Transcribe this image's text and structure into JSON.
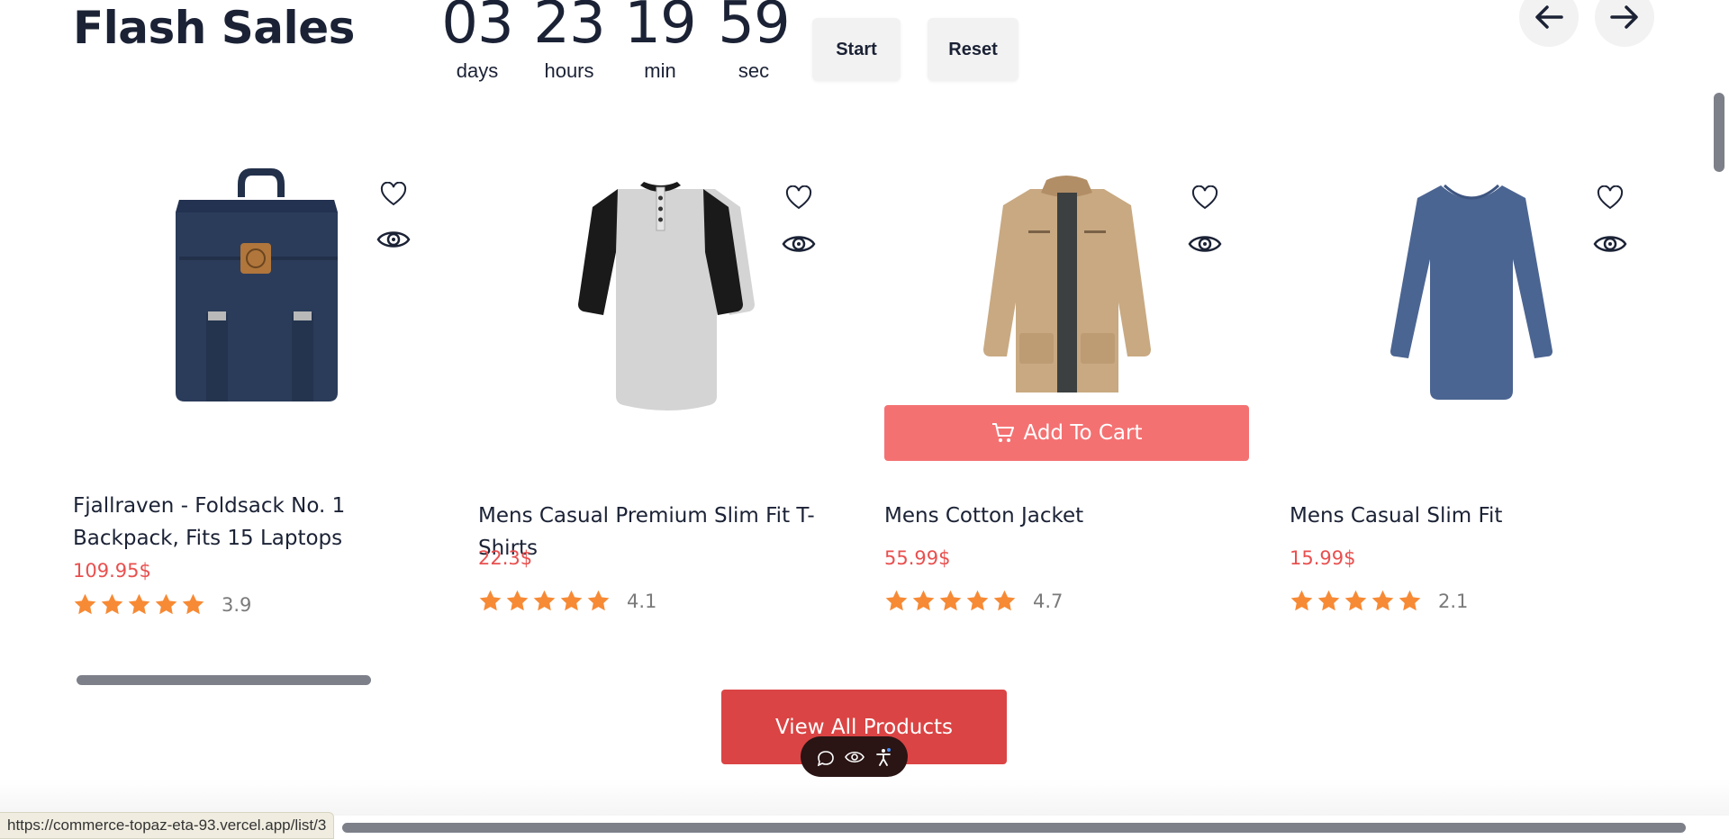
{
  "section": {
    "title": "Flash Sales"
  },
  "countdown": [
    {
      "value": "03",
      "label": "days"
    },
    {
      "value": "23",
      "label": "hours"
    },
    {
      "value": "19",
      "label": "min"
    },
    {
      "value": "59",
      "label": "sec"
    }
  ],
  "controls": {
    "start_label": "Start",
    "reset_label": "Reset"
  },
  "products": [
    {
      "name": "Fjallraven - Foldsack No. 1 Backpack, Fits 15 Laptops",
      "price": "109.95$",
      "rating": "3.9",
      "image": "backpack"
    },
    {
      "name": "Mens Casual Premium Slim Fit T-Shirts",
      "price": "22.3$",
      "rating": "4.1",
      "image": "henley-shirt"
    },
    {
      "name": "Mens Cotton Jacket",
      "price": "55.99$",
      "rating": "4.7",
      "image": "cotton-jacket"
    },
    {
      "name": "Mens Casual Slim Fit",
      "price": "15.99$",
      "rating": "2.1",
      "image": "long-sleeve-tee"
    }
  ],
  "add_to_cart_label": "Add To Cart",
  "view_all_label": "View All Products",
  "status_url": "https://commerce-topaz-eta-93.vercel.app/list/3",
  "colors": {
    "accent": "#db4444",
    "price": "#e8504f",
    "star": "#f78a35",
    "add_to_cart": "#f47172"
  }
}
